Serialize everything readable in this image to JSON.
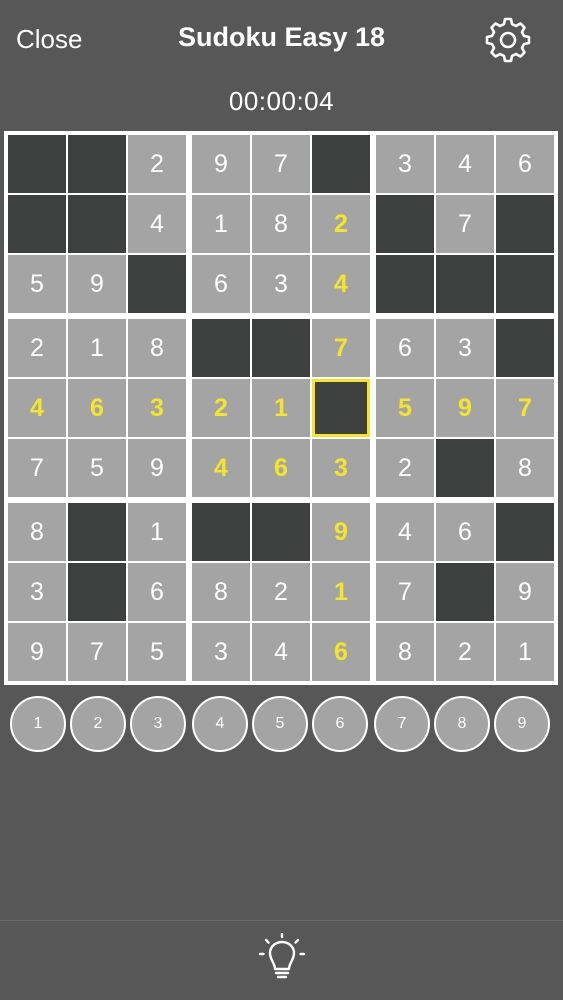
{
  "header": {
    "close_label": "Close",
    "title": "Sudoku Easy 18",
    "settings_icon": "gear-icon"
  },
  "timer": "00:00:04",
  "board": {
    "grid": [
      [
        "",
        "",
        "2",
        "9",
        "7",
        "",
        "3",
        "4",
        "6"
      ],
      [
        "",
        "",
        "4",
        "1",
        "8",
        "2",
        "",
        "7",
        ""
      ],
      [
        "5",
        "9",
        "",
        "6",
        "3",
        "4",
        "",
        "",
        ""
      ],
      [
        "2",
        "1",
        "8",
        "",
        "",
        "7",
        "6",
        "3",
        ""
      ],
      [
        "4",
        "6",
        "3",
        "2",
        "1",
        "",
        "5",
        "9",
        "7"
      ],
      [
        "7",
        "5",
        "9",
        "4",
        "6",
        "3",
        "2",
        "",
        "8"
      ],
      [
        "8",
        "",
        "1",
        "",
        "",
        "9",
        "4",
        "6",
        ""
      ],
      [
        "3",
        "",
        "6",
        "8",
        "2",
        "1",
        "7",
        "",
        "9"
      ],
      [
        "9",
        "7",
        "5",
        "3",
        "4",
        "6",
        "8",
        "2",
        "1"
      ]
    ],
    "entered": [
      [
        1,
        5
      ],
      [
        2,
        5
      ],
      [
        3,
        5
      ],
      [
        4,
        0
      ],
      [
        4,
        1
      ],
      [
        4,
        2
      ],
      [
        4,
        3
      ],
      [
        4,
        4
      ],
      [
        4,
        6
      ],
      [
        4,
        7
      ],
      [
        4,
        8
      ],
      [
        5,
        3
      ],
      [
        5,
        4
      ],
      [
        5,
        5
      ],
      [
        6,
        5
      ],
      [
        7,
        5
      ],
      [
        8,
        5
      ]
    ],
    "selected": [
      4,
      5
    ]
  },
  "number_pad": [
    "1",
    "2",
    "3",
    "4",
    "5",
    "6",
    "7",
    "8",
    "9"
  ],
  "hint_icon": "lightbulb-icon",
  "colors": {
    "background": "#575757",
    "filled_cell": "#a4a4a4",
    "empty_cell": "#3e403f",
    "entered_digit": "#f5e52a",
    "given_digit": "#ffffff",
    "grid_lines": "#ffffff",
    "selection": "#f5e52a"
  }
}
